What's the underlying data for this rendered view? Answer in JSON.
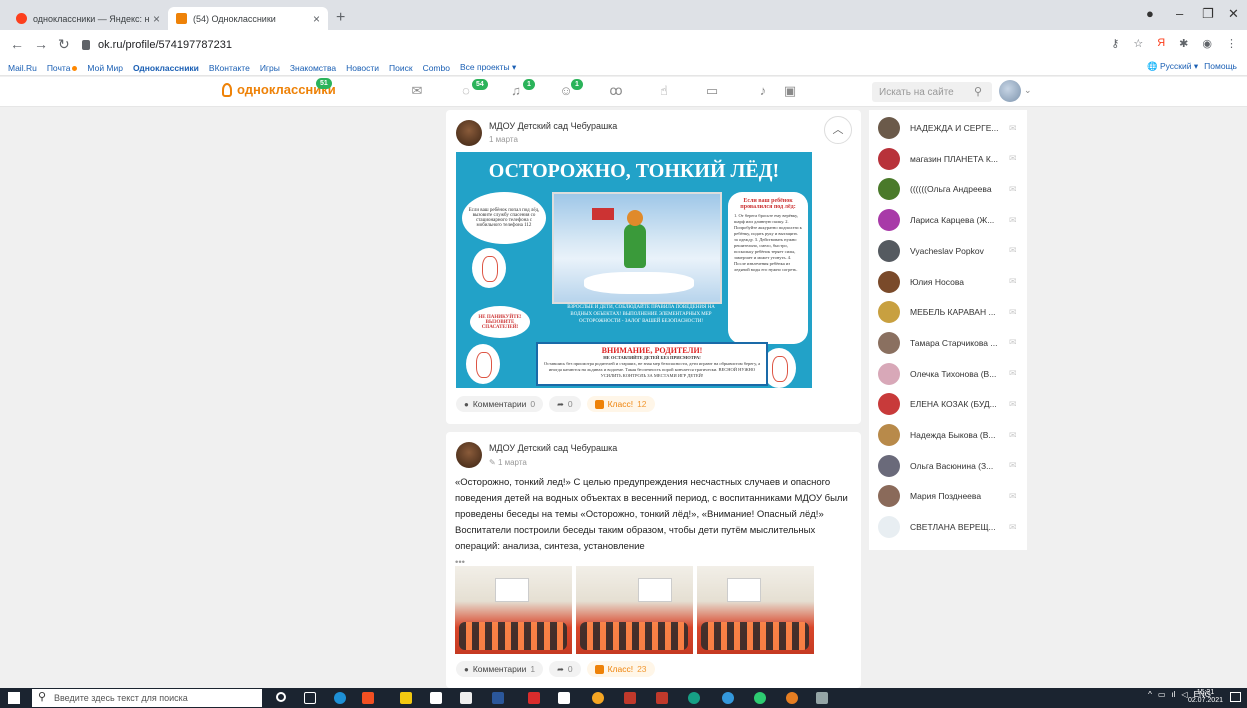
{
  "browser": {
    "tabs": [
      {
        "title": "одноклассники — Яндекс: нашл",
        "active": false
      },
      {
        "title": "(54) Одноклассники",
        "active": true
      }
    ],
    "url": "ok.ru/profile/574197787231",
    "bookmarks": [
      "Mail.Ru",
      "Почта",
      "Мой Мир",
      "Одноклассники",
      "ВКонтакте",
      "Игры",
      "Знакомства",
      "Новости",
      "Поиск",
      "Combo",
      "Все проекты ▾"
    ],
    "bookmarks_right": {
      "lang": "Русский ▾",
      "help": "Помощь"
    }
  },
  "ok": {
    "logo_text": "одноклассники",
    "logo_badge": "51",
    "badges": {
      "discussions": "54",
      "notifications": "1",
      "friends": "1"
    },
    "search_placeholder": "Искать на сайте"
  },
  "posts": [
    {
      "author": "МДОУ Детский сад Чебурашка",
      "date": "1 марта",
      "poster": {
        "title": "ОСТОРОЖНО, ТОНКИЙ ЛЁД!",
        "bubble_left": "Если ваш ребёнок попал под лёд, вызовите службу спасения со стационарного телефона с мобильного телефона 112",
        "rules_title": "Если ваш ребёнок провалился под лёд:",
        "rules_text": "1. От берега бросьте ему верёвку, шарф или длинную палку. 2. Попробуйте аккуратно подползти к ребёнку, подать руку и вытащить за одежду. 3. Действовать нужно решительно, смело, быстро, поскольку ребёнок теряет силы, замерзает и может утонуть. 4. После извлечения ребёнка из ледяной воды его нужно согреть.",
        "callout": "НЕ ПАНИКУЙТЕ! ВЫЗОВИТЕ СПАСАТЕЛЕЙ!",
        "mid_text": "ВЗРОСЛЫЕ И ДЕТИ, СОБЛЮДАЙТЕ ПРАВИЛА ПОВЕДЕНИЯ НА ВОДНЫХ ОБЪЕКТАХ! ВЫПОЛНЕНИЕ ЭЛЕМЕНТАРНЫХ МЕР ОСТОРОЖНОСТИ - ЗАЛОГ ВАШЕЙ БЕЗОПАСНОСТИ!",
        "warn_title": "ВНИМАНИЕ, РОДИТЕЛИ!",
        "warn_sub": "НЕ ОСТАВЛЯЙТЕ ДЕТЕЙ БЕЗ ПРИСМОТРА!",
        "warn_text": "Оставшись без присмотра родителей и старших, не зная мер безопасности, дети играют на обрывистом берегу, а иногда катаются на льдинах и водоеме. Такая беспечность порой кончается трагически. ВЕСНОЙ НУЖНО УСИЛИТЬ КОНТРОЛЬ ЗА МЕСТАМИ ИГР ДЕТЕЙ!"
      },
      "comments_label": "Комментарии",
      "comments": "0",
      "shares": "0",
      "klass_label": "Класс!",
      "klass": "12"
    },
    {
      "author": "МДОУ Детский сад Чебурашка",
      "date": "1 марта",
      "text": "«Осторожно, тонкий лед!» С целью предупреждения  несчастных случаев и опасного поведения детей на водных объектах в весенний период,  с воспитанниками  МДОУ были проведены беседы на темы «Осторожно, тонкий лёд!», «Внимание! Опасный лёд!» Воспитатели построили  беседы таким образом, чтобы дети путём мыслительных операций: анализа, синтеза, установление",
      "more": "•••",
      "comments_label": "Комментарии",
      "comments": "1",
      "shares": "0",
      "klass_label": "Класс!",
      "klass": "23"
    }
  ],
  "friends": [
    {
      "name": "НАДЕЖДА И СЕРГЕ...",
      "color": "#6b5a4a"
    },
    {
      "name": "магазин ПЛАНЕТА К...",
      "color": "#b8323a"
    },
    {
      "name": "((((((Ольга Андреева",
      "color": "#4a7a2a"
    },
    {
      "name": "Лариса Карцева (Ж...",
      "color": "#a83aa8"
    },
    {
      "name": "Vyacheslav Popkov",
      "color": "#555a60"
    },
    {
      "name": "Юлия Носова",
      "color": "#7a4a2a"
    },
    {
      "name": "МЕБЕЛЬ КАРАВАН ...",
      "color": "#c8a040"
    },
    {
      "name": "Тамара Старчикова ...",
      "color": "#8a7060"
    },
    {
      "name": "Олечка Тихонова (В...",
      "color": "#d8a8b8"
    },
    {
      "name": "ЕЛЕНА КОЗАК (БУД...",
      "color": "#c83a3a"
    },
    {
      "name": "Надежда Быкова (В...",
      "color": "#b88a4a"
    },
    {
      "name": "Ольга Васюнина (З...",
      "color": "#6a6a7a"
    },
    {
      "name": "Мария Позднеева",
      "color": "#8a6a5a"
    },
    {
      "name": "СВЕТЛАНА ВЕРЕЩ...",
      "color": "#e8eef2"
    }
  ],
  "taskbar": {
    "search_placeholder": "Введите здесь текст для поиска",
    "lang": "ENG",
    "time": "15:21",
    "date": "02.07.2021"
  }
}
